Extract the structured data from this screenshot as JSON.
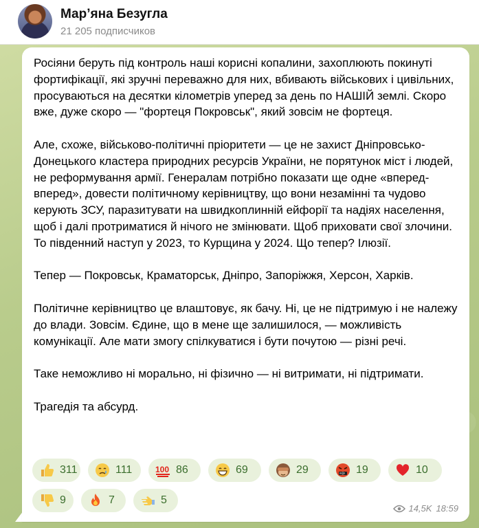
{
  "channel": {
    "title": "Мар’яна Безугла",
    "subscribers": "21 205 подписчиков"
  },
  "post": {
    "paragraphs": [
      "Росіяни беруть під контроль наші корисні копалини, захоплюють покинуті фортифікації, які зручні переважно для них, вбивають військових і цивільних, просуваються на десятки кілометрів уперед за день по НАШІЙ землі. Скоро вже, дуже скоро — \"фортеця Покровськ\", який зовсім не фортеця.",
      "Але, схоже, військово-політичні пріоритети — це не захист Дніпровсько-Донецького кластера природних ресурсів України, не порятунок міст і людей, не реформування армії. Генералам потрібно показати ще одне «вперед-вперед», довести політичному керівництву, що вони незамінні та чудово керують ЗСУ, паразитувати на швидкоплинній ейфорії та надіях населення, щоб і далі протриматися й нічого не змінювати. Щоб приховати свої злочини. То південний наступ у 2023, то Курщина у 2024. Що тепер? Ілюзії.",
      "Тепер — Покровськ, Краматорськ, Дніпро, Запоріжжя, Херсон, Харків.",
      "Політичне керівництво це влаштовує, як бачу. Ні, це не підтримую і не належу до влади. Зовсім. Єдине, що в мене ще залишилося, — можливість комунікації. Але мати змогу спілкуватися і бути почутою — різні речі.",
      "Таке неможливо ні морально, ні фізично — ні витримати, ні підтримати.",
      "Трагедія та абсурд."
    ],
    "reactions": [
      {
        "icon": "thumbs-up-icon",
        "count": "311"
      },
      {
        "icon": "crying-face-icon",
        "count": "111"
      },
      {
        "icon": "hundred-points-icon",
        "count": "86"
      },
      {
        "icon": "grinning-face-icon",
        "count": "69"
      },
      {
        "icon": "see-no-evil-monkey-icon",
        "count": "29"
      },
      {
        "icon": "face-with-symbols-on-mouth-icon",
        "count": "19"
      },
      {
        "icon": "red-heart-icon",
        "count": "10"
      },
      {
        "icon": "thumbs-down-icon",
        "count": "9"
      },
      {
        "icon": "fire-icon",
        "count": "7"
      },
      {
        "icon": "leftwards-pushing-hand-icon",
        "count": "5"
      }
    ],
    "views": "14,5K",
    "time": "18:59"
  }
}
